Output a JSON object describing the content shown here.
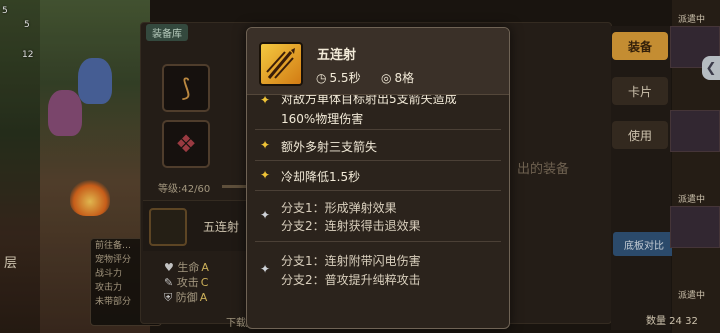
{
  "background": {
    "left_levels": [
      "5",
      "5",
      "12"
    ],
    "tab_label": "装备库",
    "level_label": "等级:42/60",
    "hint_text": "出的装备",
    "skill_row_name": "五连射",
    "left_level": "层",
    "side_tooltip_lines": [
      "前往备…",
      "宠物评分",
      "战斗力",
      "攻击力",
      "未带部分"
    ],
    "stats": [
      {
        "key": "生命",
        "value": "A"
      },
      {
        "key": "攻击",
        "value": "C"
      },
      {
        "key": "防御",
        "value": "A"
      }
    ],
    "bottom_text": "下载/拖动装",
    "right_buttons": {
      "equip": "装备",
      "card": "卡片",
      "use": "使用"
    },
    "compare_button": "底板对比",
    "dispatch_labels": [
      "派遣中",
      "派遣中",
      "派遣中"
    ],
    "count_text": "数量 24 32"
  },
  "tooltip": {
    "skill_name": "五连射",
    "cooldown": "5.5秒",
    "range": "8格",
    "cooldown_icon": "clock-icon",
    "range_icon": "target-icon",
    "entries": [
      {
        "star": "gold",
        "lines": [
          "对敌方单体目标射出5支箭矢造成",
          "160%物理伤害"
        ]
      },
      {
        "star": "gold",
        "lines": [
          "额外多射三支箭失"
        ]
      },
      {
        "star": "gold",
        "lines": [
          "冷却降低1.5秒"
        ]
      },
      {
        "star": "silver",
        "lines": [
          "分支1：形成弹射效果",
          "分支2：连射获得击退效果"
        ]
      },
      {
        "star": "silver",
        "lines": [
          "分支1：连射附带闪电伤害",
          "分支2：普攻提升纯粹攻击"
        ]
      }
    ]
  },
  "colors": {
    "gold_star": "#f0c437",
    "silver_star": "#cfd3d8",
    "equip_button": "#e0a13a",
    "compare_button": "#32557a"
  }
}
